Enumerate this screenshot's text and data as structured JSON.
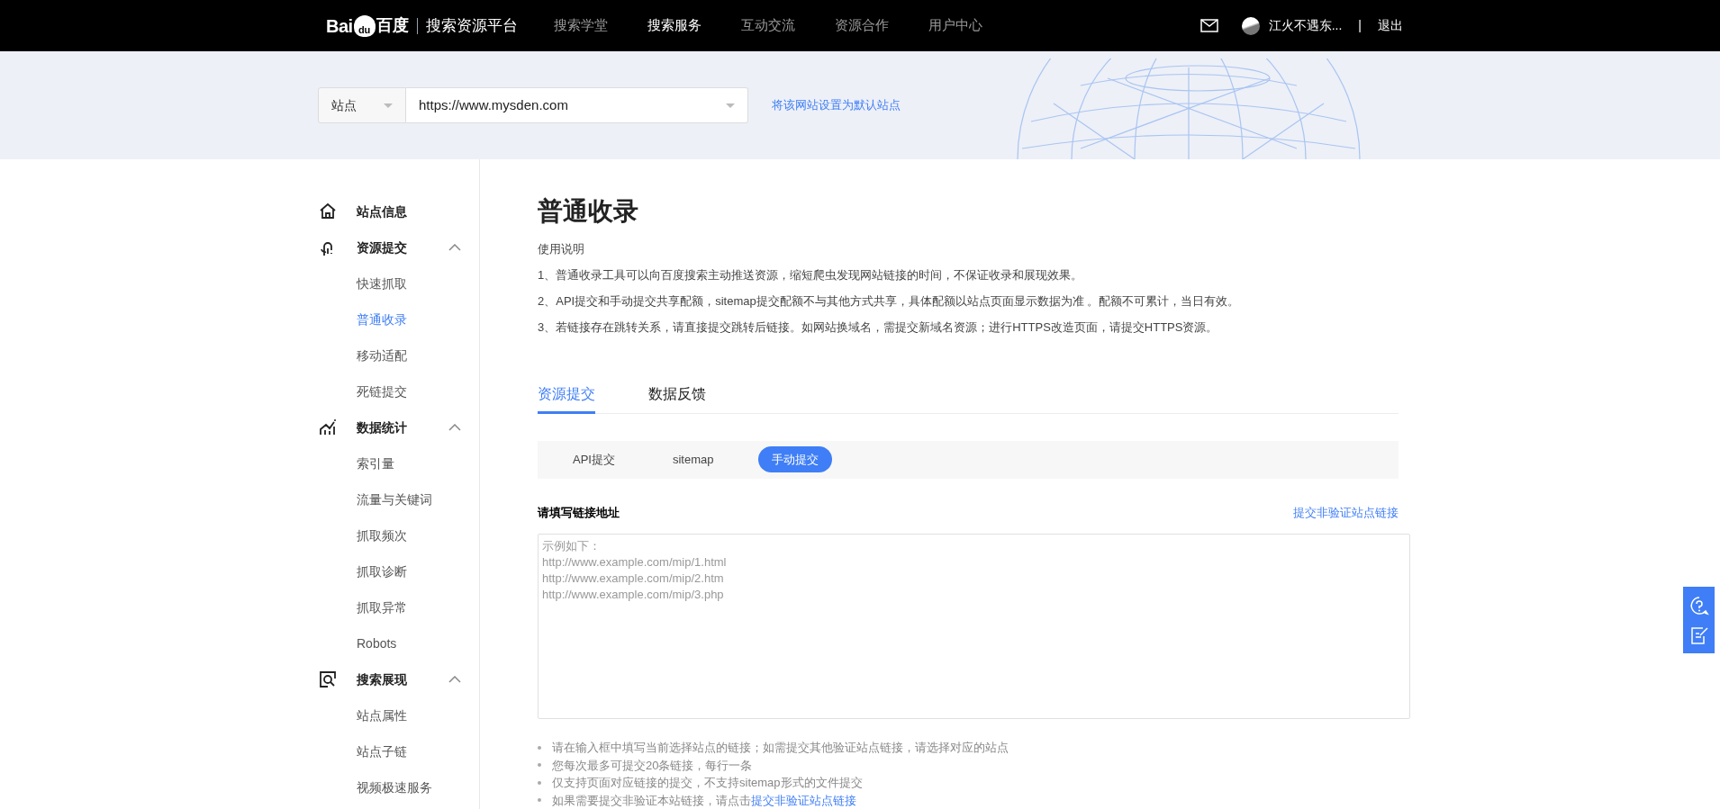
{
  "topbar": {
    "logo": {
      "left": "Bai",
      "paw": "du",
      "right": "百度"
    },
    "platform": "搜索资源平台",
    "nav": [
      {
        "label": "搜索学堂",
        "selected": false
      },
      {
        "label": "搜索服务",
        "selected": true
      },
      {
        "label": "互动交流",
        "selected": false
      },
      {
        "label": "资源合作",
        "selected": false
      },
      {
        "label": "用户中心",
        "selected": false
      }
    ],
    "user": "江火不遇东...",
    "separator": "|",
    "logout": "退出"
  },
  "site_bar": {
    "type": "站点",
    "url": "https://www.mysden.com",
    "set_default": "将该网站设置为默认站点"
  },
  "sidebar": [
    {
      "label": "站点信息"
    },
    {
      "label": "资源提交",
      "expanded": true,
      "children": [
        {
          "label": "快速抓取",
          "selected": false
        },
        {
          "label": "普通收录",
          "selected": true
        },
        {
          "label": "移动适配",
          "selected": false
        },
        {
          "label": "死链提交",
          "selected": false
        }
      ]
    },
    {
      "label": "数据统计",
      "expanded": true,
      "children": [
        {
          "label": "索引量",
          "selected": false
        },
        {
          "label": "流量与关键词",
          "selected": false
        },
        {
          "label": "抓取频次",
          "selected": false
        },
        {
          "label": "抓取诊断",
          "selected": false
        },
        {
          "label": "抓取异常",
          "selected": false
        },
        {
          "label": "Robots",
          "selected": false
        }
      ]
    },
    {
      "label": "搜索展现",
      "expanded": true,
      "children": [
        {
          "label": "站点属性",
          "selected": false
        },
        {
          "label": "站点子链",
          "selected": false
        },
        {
          "label": "视频极速服务",
          "selected": false
        }
      ]
    }
  ],
  "main": {
    "title": "普通收录",
    "intro_heading": "使用说明",
    "intro": [
      "1、普通收录工具可以向百度搜索主动推送资源，缩短爬虫发现网站链接的时间，不保证收录和展现效果。",
      "2、API提交和手动提交共享配额，sitemap提交配额不与其他方式共享，具体配额以站点页面显示数据为准 。配额不可累计，当日有效。",
      "3、若链接存在跳转关系，请直接提交跳转后链接。如网站换域名，需提交新域名资源；进行HTTPS改造页面，请提交HTTPS资源。"
    ],
    "tabs": [
      {
        "label": "资源提交",
        "selected": true
      },
      {
        "label": "数据反馈",
        "selected": false
      }
    ],
    "methods": [
      {
        "label": "API提交",
        "selected": false
      },
      {
        "label": "sitemap",
        "selected": false
      },
      {
        "label": "手动提交",
        "selected": true
      }
    ],
    "field_label": "请填写链接地址",
    "other_link": "提交非验证站点链接",
    "placeholder": "示例如下：\nhttp://www.example.com/mip/1.html\nhttp://www.example.com/mip/2.htm\nhttp://www.example.com/mip/3.php",
    "notes": [
      "请在输入框中填写当前选择站点的链接；如需提交其他验证站点链接，请选择对应的站点",
      "您每次最多可提交20条链接，每行一条",
      "仅支持页面对应链接的提交，不支持sitemap形式的文件提交"
    ],
    "last_note": {
      "text": "如果需要提交非验证本站链接，请点击",
      "link": "提交非验证站点链接"
    }
  }
}
